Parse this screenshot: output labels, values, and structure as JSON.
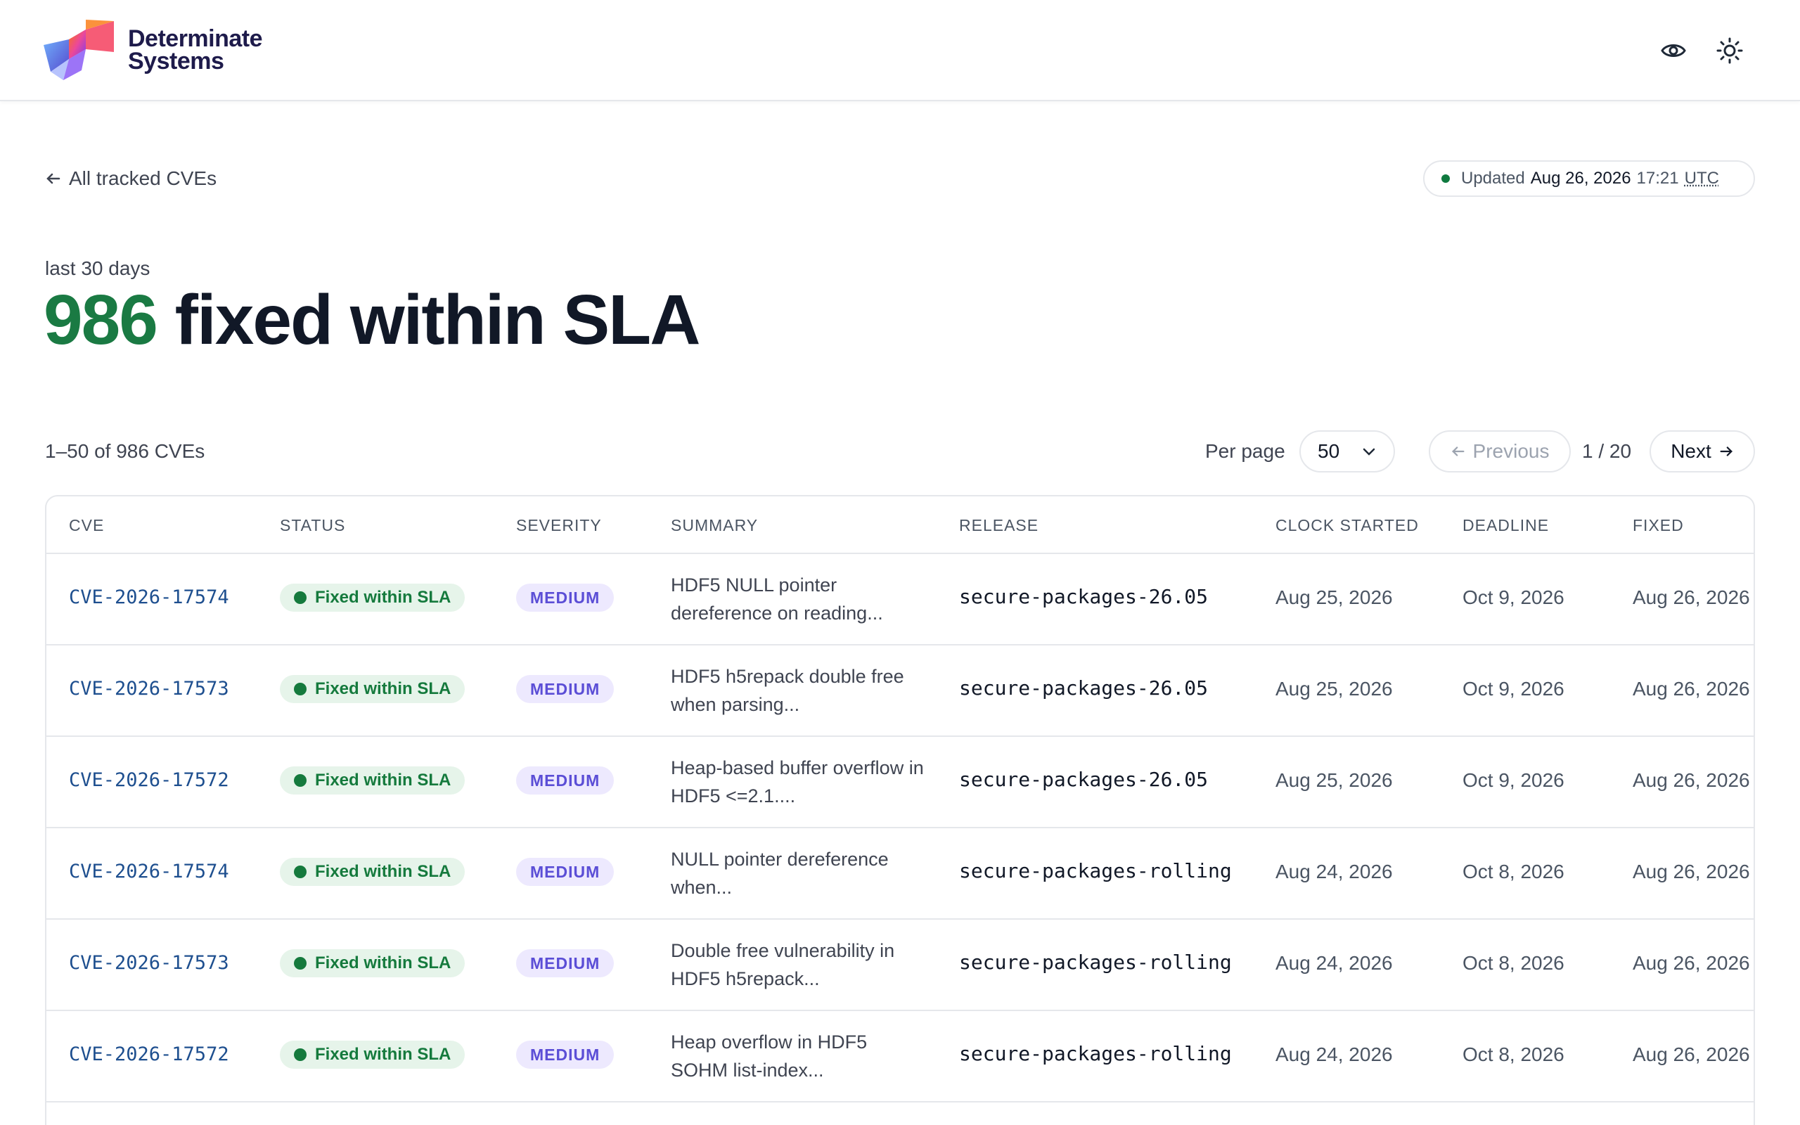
{
  "brand": {
    "line1": "Determinate",
    "line2": "Systems"
  },
  "header_icons": [
    "eye-icon",
    "sun-icon"
  ],
  "back_link": "All tracked CVEs",
  "updated": {
    "label": "Updated",
    "date": "Aug 26, 2026",
    "time": "17:21",
    "tz": "UTC"
  },
  "period": "last 30 days",
  "headline": {
    "count": "986",
    "text": "fixed within SLA"
  },
  "pager": {
    "range": "1–50 of 986 CVEs",
    "per_page_label": "Per page",
    "per_page_value": "50",
    "prev_label": "Previous",
    "page_indicator": "1 / 20",
    "next_label": "Next"
  },
  "table": {
    "columns": [
      "CVE",
      "STATUS",
      "SEVERITY",
      "SUMMARY",
      "RELEASE",
      "CLOCK STARTED",
      "DEADLINE",
      "FIXED"
    ],
    "rows": [
      {
        "cve": "CVE-2026-17574",
        "status": "Fixed within SLA",
        "severity": "MEDIUM",
        "summary": "HDF5 NULL pointer dereference on reading...",
        "release": "secure-packages-26.05",
        "clock_started": "Aug 25, 2026",
        "deadline": "Oct 9, 2026",
        "fixed": "Aug 26, 2026"
      },
      {
        "cve": "CVE-2026-17573",
        "status": "Fixed within SLA",
        "severity": "MEDIUM",
        "summary": "HDF5 h5repack double free when parsing...",
        "release": "secure-packages-26.05",
        "clock_started": "Aug 25, 2026",
        "deadline": "Oct 9, 2026",
        "fixed": "Aug 26, 2026"
      },
      {
        "cve": "CVE-2026-17572",
        "status": "Fixed within SLA",
        "severity": "MEDIUM",
        "summary": "Heap-based buffer overflow in HDF5 <=2.1....",
        "release": "secure-packages-26.05",
        "clock_started": "Aug 25, 2026",
        "deadline": "Oct 9, 2026",
        "fixed": "Aug 26, 2026"
      },
      {
        "cve": "CVE-2026-17574",
        "status": "Fixed within SLA",
        "severity": "MEDIUM",
        "summary": "NULL pointer dereference when...",
        "release": "secure-packages-rolling",
        "clock_started": "Aug 24, 2026",
        "deadline": "Oct 8, 2026",
        "fixed": "Aug 26, 2026"
      },
      {
        "cve": "CVE-2026-17573",
        "status": "Fixed within SLA",
        "severity": "MEDIUM",
        "summary": "Double free vulnerability in HDF5 h5repack...",
        "release": "secure-packages-rolling",
        "clock_started": "Aug 24, 2026",
        "deadline": "Oct 8, 2026",
        "fixed": "Aug 26, 2026"
      },
      {
        "cve": "CVE-2026-17572",
        "status": "Fixed within SLA",
        "severity": "MEDIUM",
        "summary": "Heap overflow in HDF5 SOHM list-index...",
        "release": "secure-packages-rolling",
        "clock_started": "Aug 24, 2026",
        "deadline": "Oct 8, 2026",
        "fixed": "Aug 26, 2026"
      }
    ]
  }
}
